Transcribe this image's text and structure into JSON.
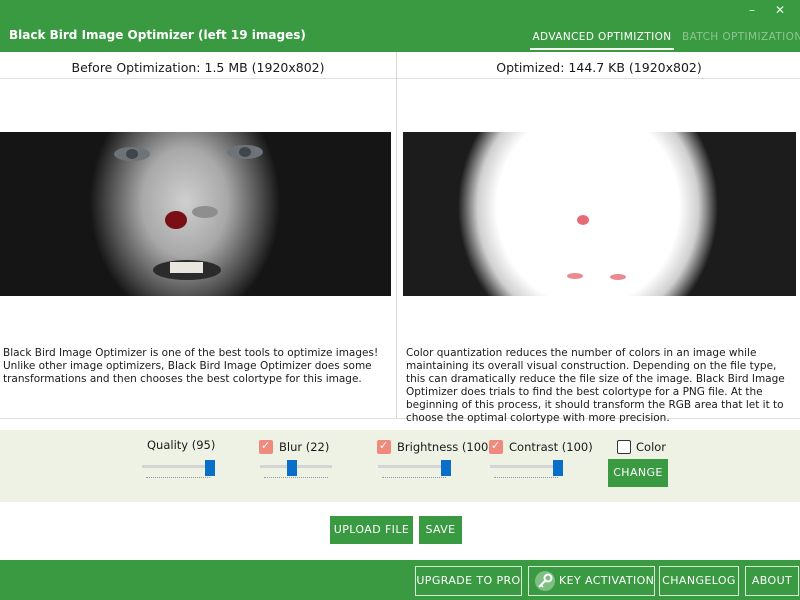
{
  "window": {
    "minimize_glyph": "–",
    "close_glyph": "✕"
  },
  "header": {
    "title": "Black Bird Image Optimizer (left 19 images)",
    "tabs": [
      {
        "label": "ADVANCED OPTIMIZTION",
        "active": true
      },
      {
        "label": "BATCH OPTIMIZATION",
        "active": false
      }
    ]
  },
  "panels": {
    "before": {
      "title": "Before Optimization: 1.5 MB (1920x802)",
      "description": "Black Bird Image Optimizer is one of the best tools to optimize images! Unlike other image optimizers, Black Bird Image Optimizer does some transformations and then chooses the best colortype for this image."
    },
    "after": {
      "title": "Optimized: 144.7 KB (1920x802)",
      "description": "Color quantization reduces the number of colors in an image while maintaining its overall visual construction. Depending on the file type, this can dramatically reduce the file size of the image. Black Bird Image Optimizer does trials to find the best colortype for a PNG file. At the beginning of this process, it should transform the RGB area that let it to choose the optimal colortype with more precision."
    }
  },
  "controls": {
    "quality": {
      "label": "Quality (95)",
      "level_fraction": 0.95
    },
    "blur": {
      "label": "Blur (22)",
      "checked": true,
      "level_fraction": 0.44
    },
    "brightness": {
      "label": "Brightness (100)",
      "checked": true,
      "level_fraction": 0.95
    },
    "contrast": {
      "label": "Contrast (100)",
      "checked": true,
      "level_fraction": 0.95
    },
    "color": {
      "label": "Color",
      "checked": false
    },
    "change_label": "CHANGE"
  },
  "actions": {
    "upload_label": "UPLOAD FILE",
    "save_label": "SAVE"
  },
  "footer": {
    "upgrade_label": "UPGRADE TO PRO",
    "key_activation_label": "KEY ACTIVATION",
    "changelog_label": "CHANGELOG",
    "about_label": "ABOUT"
  },
  "colors": {
    "brand_green": "#3a9a42",
    "checkbox_checked": "#f08a7d",
    "slider_thumb": "#0a6fc8",
    "controls_background": "#eef2e4"
  },
  "icons": [
    "minimize-icon",
    "close-icon",
    "key-icon",
    "check-icon"
  ]
}
